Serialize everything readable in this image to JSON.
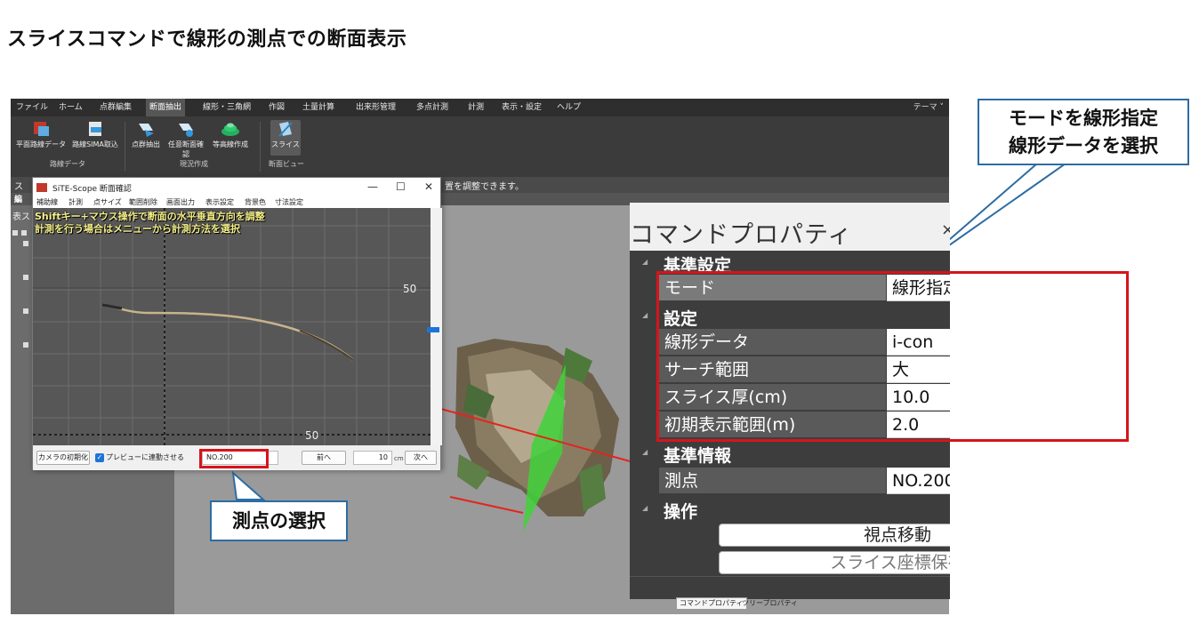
{
  "page_title": "スライスコマンドで線形の測点での断面表示",
  "app": {
    "menu": [
      "ファイル",
      "ホーム",
      "点群編集",
      "断面抽出",
      "線形・三角網",
      "作図",
      "土量計算",
      "出来形管理",
      "多点計測",
      "計測",
      "表示・設定",
      "ヘルプ"
    ],
    "theme_label": "テーマ ˅",
    "ribbon": {
      "btn_1": "平面路線データ",
      "btn_2": "路線SIMA取込",
      "btn_3": "点群抽出",
      "btn_4": "任意断面確認",
      "btn_5": "等高線作成",
      "btn_6": "スライス",
      "group_1": "路線データ",
      "group_2": "現況作成",
      "group_3": "断面ビュー"
    },
    "status_left": "ス",
    "status_right": "置を調整できます。",
    "tab_left": "編",
    "panel_label": "表ス"
  },
  "dialog": {
    "title": "SiTE-Scope 断面確認",
    "min_glyph": "—",
    "max_glyph": "☐",
    "close_glyph": "✕",
    "menu": [
      "補助線",
      "計測",
      "点サイズ",
      "範囲削除",
      "画面出力",
      "表示設定",
      "背景色",
      "寸法設定"
    ],
    "overlay_1": "Shiftキー+マウス操作で断面の水平垂直方向を調整",
    "overlay_2": "計測を行う場合はメニューから計測方法を選択",
    "label_50_right": "50",
    "label_50_bottom": "50",
    "btn_reset_camera": "カメラの初期化",
    "check_glyph": "✓",
    "preview_label": "プレビューに連動させる",
    "station_value": "NO.200",
    "prev_button": "前へ",
    "step_value": "10",
    "unit": "cm",
    "next_button": "次へ"
  },
  "property_panel": {
    "title": "コマンドプロパティ",
    "close_glyph": "×",
    "cat_basic": "基準設定",
    "mode_label": "モード",
    "mode_value": "線形指定",
    "cat_setting": "設定",
    "alignment_label": "線形データ",
    "alignment_value": "i-con",
    "search_label": "サーチ範囲",
    "search_value": "大",
    "thickness_label": "スライス厚(cm)",
    "thickness_value": "10.0",
    "initial_label": "初期表示範囲(m)",
    "initial_value": "2.0",
    "cat_info": "基準情報",
    "station_label": "測点",
    "station_value": "NO.200",
    "cat_ops": "操作",
    "btn_view_move": "視点移動",
    "btn_save_slice": "スライス座標保存",
    "expand_glyph": "◢"
  },
  "bottom_tabs": {
    "cmd_prop": "コマンドプロパティ",
    "tree_prop": "ツリープロパティ"
  },
  "callouts": {
    "top_right_1": "モードを線形指定",
    "top_right_2": "線形データを選択",
    "bottom_left": "測点の選択"
  },
  "colors": {
    "callout_border": "#2e6ca3",
    "highlight_red": "#d6141c",
    "slice_plane": "#3fd23a",
    "overlay_text": "#f6f08a"
  }
}
